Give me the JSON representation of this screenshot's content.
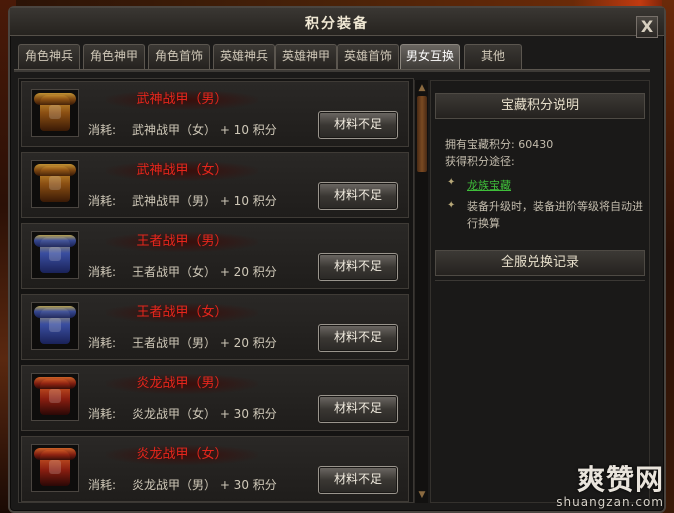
{
  "window": {
    "title": "积分装备",
    "close_label": "X"
  },
  "tabs": [
    {
      "label": "角色神兵",
      "active": false
    },
    {
      "label": "角色神甲",
      "active": false
    },
    {
      "label": "角色首饰",
      "active": false
    },
    {
      "label": "英雄神兵",
      "active": false
    },
    {
      "label": "英雄神甲",
      "active": false
    },
    {
      "label": "英雄首饰",
      "active": false
    },
    {
      "label": "男女互换",
      "active": true
    },
    {
      "label": "其他",
      "active": false
    }
  ],
  "items": [
    {
      "name": "武神战甲（男）",
      "cost_label": "消耗:",
      "cost": "武神战甲（女） + 10 积分",
      "button": "材料不足",
      "icon": "gold-armor-icon"
    },
    {
      "name": "武神战甲（女）",
      "cost_label": "消耗:",
      "cost": "武神战甲（男） + 10 积分",
      "button": "材料不足",
      "icon": "gold-armor-icon"
    },
    {
      "name": "王者战甲（男）",
      "cost_label": "消耗:",
      "cost": "王者战甲（女） + 20 积分",
      "button": "材料不足",
      "icon": "blue-armor-icon"
    },
    {
      "name": "王者战甲（女）",
      "cost_label": "消耗:",
      "cost": "王者战甲（男） + 20 积分",
      "button": "材料不足",
      "icon": "blue-armor-icon"
    },
    {
      "name": "炎龙战甲（男）",
      "cost_label": "消耗:",
      "cost": "炎龙战甲（女） + 30 积分",
      "button": "材料不足",
      "icon": "red-armor-icon"
    },
    {
      "name": "炎龙战甲（女）",
      "cost_label": "消耗:",
      "cost": "炎龙战甲（男） + 30 积分",
      "button": "材料不足",
      "icon": "red-armor-icon"
    }
  ],
  "info": {
    "header": "宝藏积分说明",
    "points_line": "拥有宝藏积分: 60430",
    "ways_line": "获得积分途径:",
    "way1": "龙族宝藏",
    "way2": "装备升级时，装备进阶等级将自动进行换算",
    "record_header": "全服兑换记录"
  },
  "watermark": {
    "big": "爽赞网",
    "small": "shuangzan.com"
  },
  "colors": {
    "item_name": "#e5261c",
    "link": "#3fbf3a",
    "accent": "#7a4a22"
  }
}
